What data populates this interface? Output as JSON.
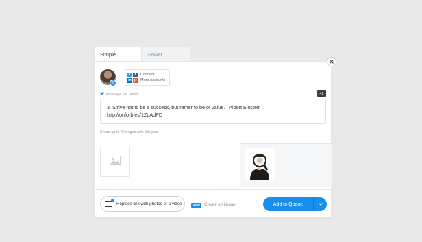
{
  "tabs": [
    {
      "label": "Simple Composer",
      "active": true
    },
    {
      "label": "Power Scheduler",
      "active": false
    }
  ],
  "profile": {
    "network_badge": "t"
  },
  "connect": {
    "line1": "Connect",
    "line2": "More Accounts",
    "networks": [
      {
        "icon": "twitter-icon",
        "glyph": "t",
        "color": "#3b99e0"
      },
      {
        "icon": "facebook-icon",
        "glyph": "f",
        "color": "#3b5998"
      },
      {
        "icon": "linkedin-icon",
        "glyph": "in",
        "color": "#0077b5"
      },
      {
        "icon": "googleplus-icon",
        "glyph": "g+",
        "color": "#dd4b39"
      }
    ]
  },
  "message": {
    "label": "Message for Twitter",
    "char_count": "42",
    "text_line1": "3. Strive not to be a success, but rather to be of value. –Albert Einstein",
    "text_line2": "http://onforb.es/1ZpAdPD"
  },
  "images": {
    "hint": "Share up to 4 images with this post"
  },
  "footer": {
    "replace_link": "Replace link with photos or a video",
    "new_badge": "NEW",
    "create_image": "Create an image",
    "queue_button": "Add to Queue"
  },
  "colors": {
    "accent": "#168eea",
    "twitter": "#3b99e0",
    "badge_dark": "#393f45"
  }
}
